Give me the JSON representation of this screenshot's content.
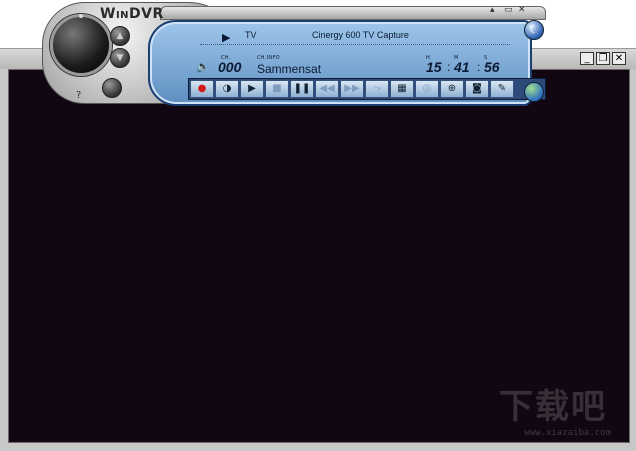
{
  "app": {
    "name": "WinDVR"
  },
  "player": {
    "source": "TV",
    "device": "Cinergy 600 TV Capture",
    "labels": {
      "ch": "CH.",
      "chinfo": "CH.INFO",
      "h": "H",
      "m": "M",
      "s": "S"
    },
    "channel_number": "000",
    "channel_name": "Sammensat",
    "clock": {
      "h": "15",
      "m": "41",
      "s": "56"
    },
    "icons": {
      "play": "▶",
      "volume": "🔈",
      "moon": "☾",
      "help": "?",
      "min": "▴",
      "restore": "▭",
      "close": "✕",
      "up": "▲",
      "down": "▼"
    },
    "buttons": [
      {
        "name": "record-button",
        "glyph": "●",
        "state": "enabled"
      },
      {
        "name": "timeshift-button",
        "glyph": "◑",
        "state": "enabled"
      },
      {
        "name": "play-button",
        "glyph": "▶",
        "state": "enabled"
      },
      {
        "name": "stop-button",
        "glyph": "■",
        "state": "disabled"
      },
      {
        "name": "pause-button",
        "glyph": "❚❚",
        "state": "enabled"
      },
      {
        "name": "rewind-button",
        "glyph": "◀◀",
        "state": "disabled"
      },
      {
        "name": "fast-forward-button",
        "glyph": "▶▶",
        "state": "disabled"
      },
      {
        "name": "skip-button",
        "glyph": "⤳",
        "state": "disabled"
      },
      {
        "name": "schedule-button",
        "glyph": "▦",
        "state": "enabled"
      },
      {
        "name": "info-button",
        "glyph": "◎",
        "state": "disabled"
      },
      {
        "name": "zoom-button",
        "glyph": "⊕",
        "state": "enabled"
      },
      {
        "name": "snapshot-button",
        "glyph": "◙",
        "state": "enabled"
      },
      {
        "name": "settings-button",
        "glyph": "✎",
        "state": "enabled"
      }
    ]
  },
  "video_window": {
    "controls": {
      "minimize": "_",
      "maximize": "❐",
      "close": "✕"
    }
  },
  "watermark": {
    "text": "下载吧",
    "url": "www.xiazaiba.com"
  },
  "colors": {
    "lcd": "#9ec6ea",
    "video": "#120612",
    "accent": "#2b5fae"
  }
}
